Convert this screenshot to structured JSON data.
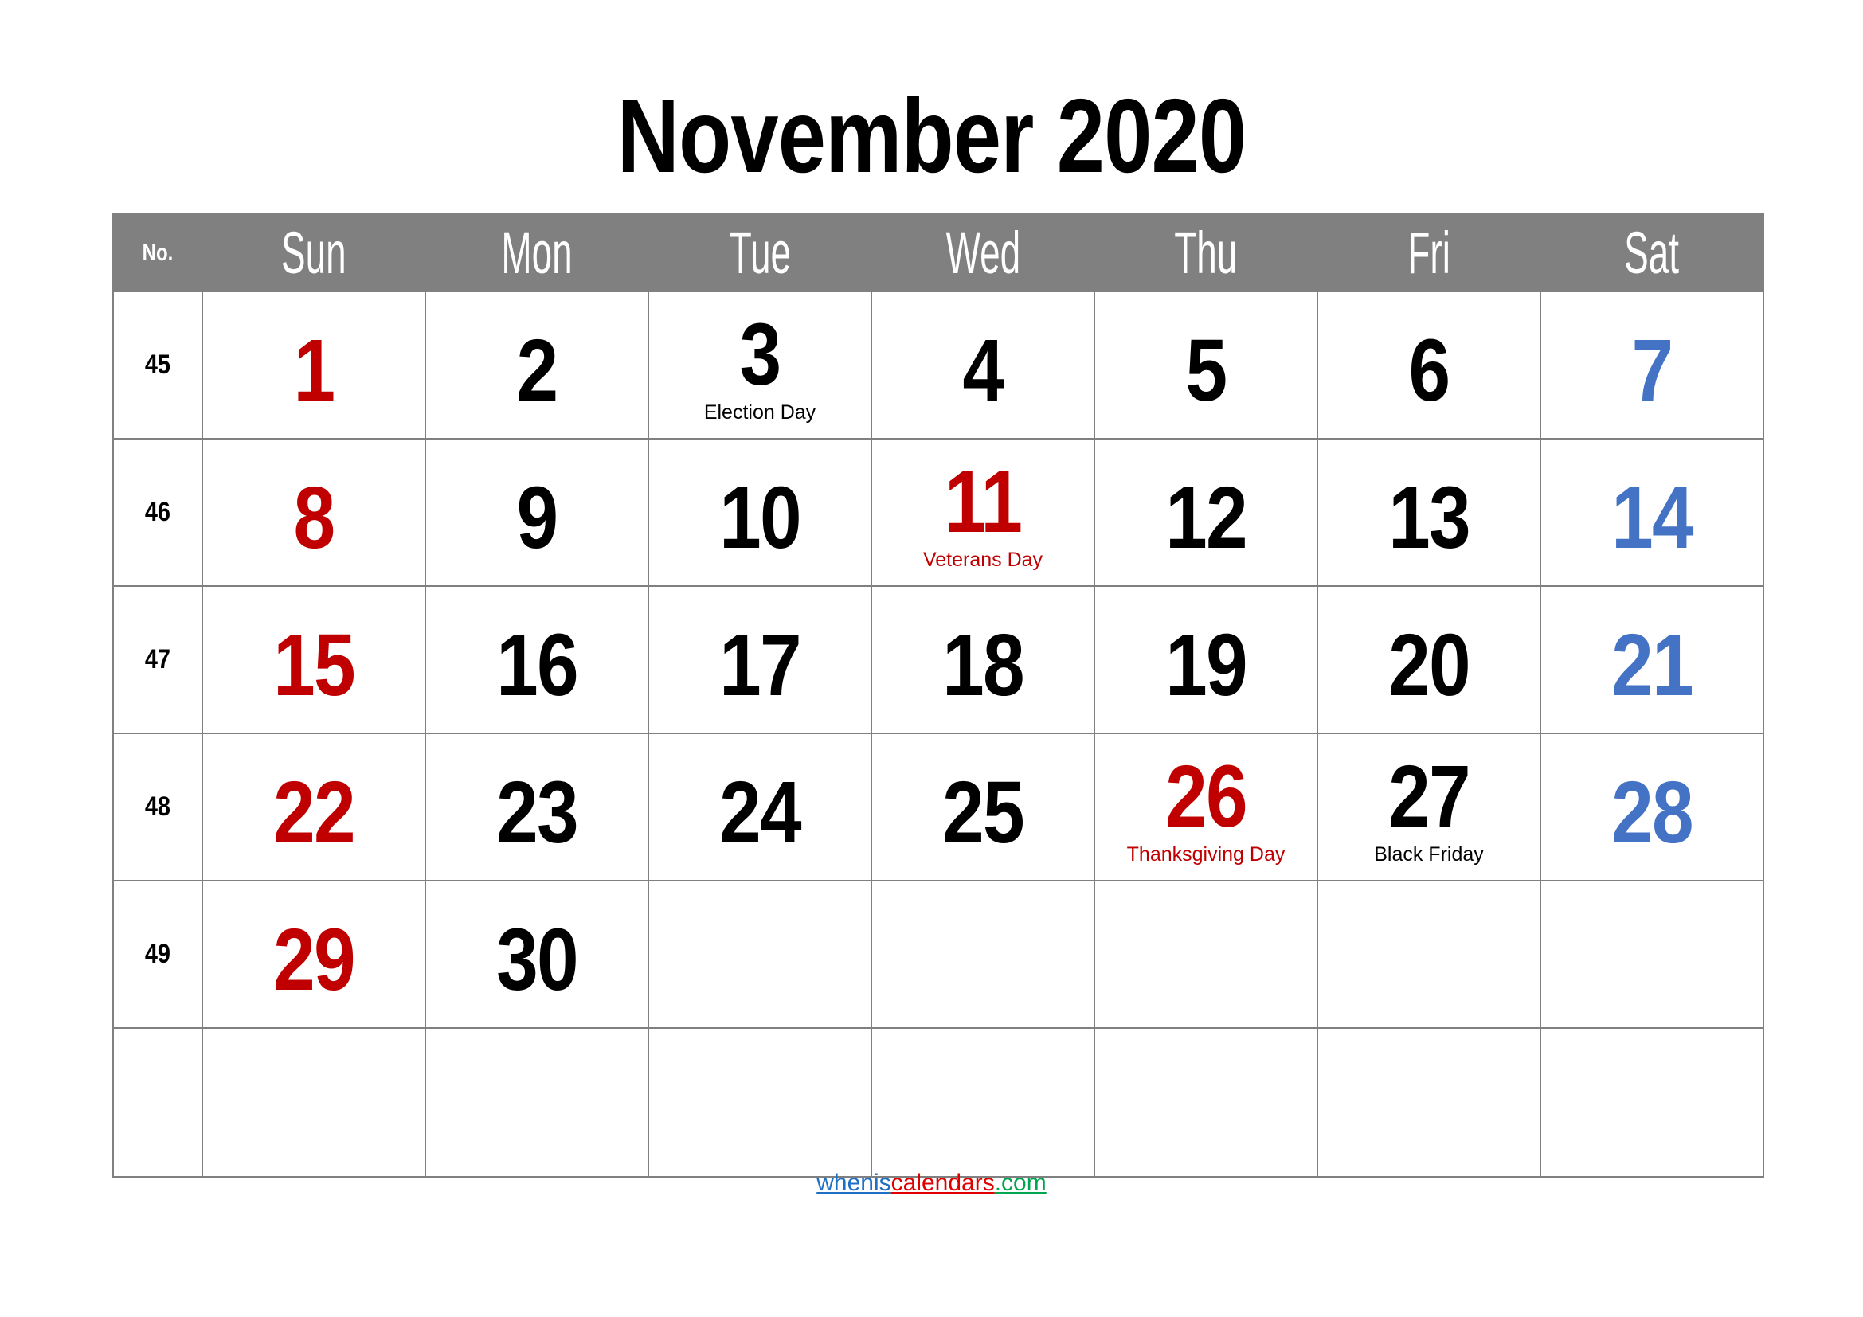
{
  "title": "November 2020",
  "header": {
    "week_no_label": "No.",
    "days": [
      "Sun",
      "Mon",
      "Tue",
      "Wed",
      "Thu",
      "Fri",
      "Sat"
    ]
  },
  "colors": {
    "header_background": "#808080",
    "grid_line": "#808080",
    "sunday_holiday": "#C00000",
    "saturday": "#4472C4",
    "weekday": "#000000"
  },
  "weeks": [
    {
      "no": "45",
      "days": [
        {
          "num": "1",
          "color": "red",
          "note": ""
        },
        {
          "num": "2",
          "color": "black",
          "note": ""
        },
        {
          "num": "3",
          "color": "black",
          "note": "Election Day",
          "note_color": "black"
        },
        {
          "num": "4",
          "color": "black",
          "note": ""
        },
        {
          "num": "5",
          "color": "black",
          "note": ""
        },
        {
          "num": "6",
          "color": "black",
          "note": ""
        },
        {
          "num": "7",
          "color": "blue",
          "note": ""
        }
      ]
    },
    {
      "no": "46",
      "days": [
        {
          "num": "8",
          "color": "red",
          "note": ""
        },
        {
          "num": "9",
          "color": "black",
          "note": ""
        },
        {
          "num": "10",
          "color": "black",
          "note": ""
        },
        {
          "num": "11",
          "color": "red",
          "note": "Veterans Day",
          "note_color": "red"
        },
        {
          "num": "12",
          "color": "black",
          "note": ""
        },
        {
          "num": "13",
          "color": "black",
          "note": ""
        },
        {
          "num": "14",
          "color": "blue",
          "note": ""
        }
      ]
    },
    {
      "no": "47",
      "days": [
        {
          "num": "15",
          "color": "red",
          "note": ""
        },
        {
          "num": "16",
          "color": "black",
          "note": ""
        },
        {
          "num": "17",
          "color": "black",
          "note": ""
        },
        {
          "num": "18",
          "color": "black",
          "note": ""
        },
        {
          "num": "19",
          "color": "black",
          "note": ""
        },
        {
          "num": "20",
          "color": "black",
          "note": ""
        },
        {
          "num": "21",
          "color": "blue",
          "note": ""
        }
      ]
    },
    {
      "no": "48",
      "days": [
        {
          "num": "22",
          "color": "red",
          "note": ""
        },
        {
          "num": "23",
          "color": "black",
          "note": ""
        },
        {
          "num": "24",
          "color": "black",
          "note": ""
        },
        {
          "num": "25",
          "color": "black",
          "note": ""
        },
        {
          "num": "26",
          "color": "red",
          "note": "Thanksgiving Day",
          "note_color": "red"
        },
        {
          "num": "27",
          "color": "black",
          "note": "Black Friday",
          "note_color": "black"
        },
        {
          "num": "28",
          "color": "blue",
          "note": ""
        }
      ]
    },
    {
      "no": "49",
      "days": [
        {
          "num": "29",
          "color": "red",
          "note": ""
        },
        {
          "num": "30",
          "color": "black",
          "note": ""
        },
        {
          "num": "",
          "color": "black",
          "note": ""
        },
        {
          "num": "",
          "color": "black",
          "note": ""
        },
        {
          "num": "",
          "color": "black",
          "note": ""
        },
        {
          "num": "",
          "color": "black",
          "note": ""
        },
        {
          "num": "",
          "color": "blue",
          "note": ""
        }
      ]
    },
    {
      "no": "",
      "days": [
        {
          "num": "",
          "color": "red",
          "note": ""
        },
        {
          "num": "",
          "color": "black",
          "note": ""
        },
        {
          "num": "",
          "color": "black",
          "note": ""
        },
        {
          "num": "",
          "color": "black",
          "note": ""
        },
        {
          "num": "",
          "color": "black",
          "note": ""
        },
        {
          "num": "",
          "color": "black",
          "note": ""
        },
        {
          "num": "",
          "color": "blue",
          "note": ""
        }
      ]
    }
  ],
  "footer": {
    "part1": "whenis",
    "part2": "calendars",
    "part3": ".com"
  }
}
